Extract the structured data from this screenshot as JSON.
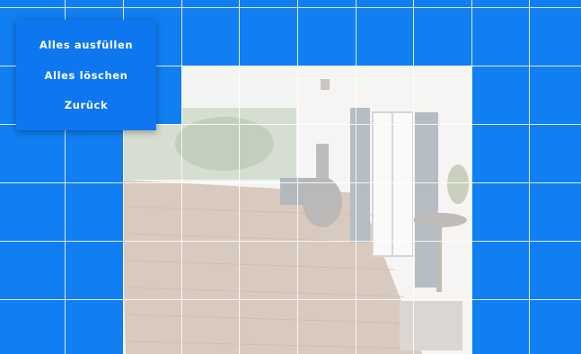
{
  "menu": {
    "items": [
      {
        "label": "Alles ausfüllen"
      },
      {
        "label": "Alles löschen"
      },
      {
        "label": "Zurück"
      }
    ]
  },
  "grid": {
    "columns": 10,
    "rows": 6,
    "cell_color": "#117ff2",
    "cleared_color": "transparent",
    "cleared_cells": [
      [
        1,
        3
      ],
      [
        1,
        4
      ],
      [
        1,
        5
      ],
      [
        1,
        6
      ],
      [
        1,
        7
      ],
      [
        2,
        3
      ],
      [
        2,
        4
      ],
      [
        2,
        5
      ],
      [
        2,
        6
      ],
      [
        2,
        7
      ],
      [
        3,
        2
      ],
      [
        3,
        3
      ],
      [
        3,
        4
      ],
      [
        3,
        5
      ],
      [
        3,
        6
      ],
      [
        3,
        7
      ],
      [
        4,
        2
      ],
      [
        4,
        3
      ],
      [
        4,
        4
      ],
      [
        4,
        5
      ],
      [
        4,
        6
      ],
      [
        4,
        7
      ],
      [
        5,
        2
      ],
      [
        5,
        3
      ],
      [
        5,
        4
      ],
      [
        5,
        5
      ],
      [
        5,
        6
      ],
      [
        5,
        7
      ],
      [
        2,
        2
      ]
    ],
    "row_one_partial": true
  }
}
